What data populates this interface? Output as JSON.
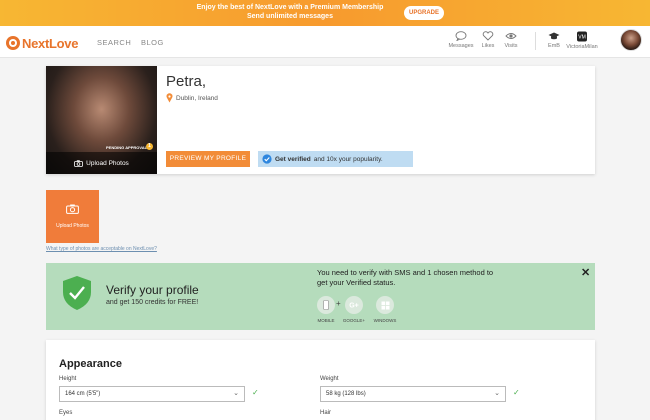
{
  "promo": {
    "line1": "Enjoy the best of NextLove with a Premium Membership",
    "line2": "Send unlimited messages",
    "upgrade_label": "UPGRADE"
  },
  "header": {
    "logo_text": "NextLove",
    "nav": {
      "search": "SEARCH",
      "blog": "BLOG"
    },
    "icons": {
      "messages": "Messages",
      "likes": "Likes",
      "visits": "Visits",
      "user1": "EmB",
      "user2": "VictoriaMilan"
    }
  },
  "profile": {
    "name": "Petra,",
    "location": "Dublin, Ireland",
    "pending_label": "PENDING APPROVAL",
    "pending_count": "1",
    "upload_label": "Upload Photos",
    "preview_label": "PREVIEW MY PROFILE",
    "verified_bold": "Get verified",
    "verified_rest": "and 10x your popularity."
  },
  "upload_tile": {
    "label": "Upload Photos",
    "link": "What type of photos are acceptable on NextLove?"
  },
  "verify": {
    "title": "Verify your profile",
    "subtitle": "and get 150 credits for FREE!",
    "text": "You need to verify with SMS and 1 chosen method to get your Verified status.",
    "close": "✕",
    "plus": "+",
    "options": [
      {
        "label": "MOBILE"
      },
      {
        "label": "GOOGLE+"
      },
      {
        "label": "WINDOWS"
      }
    ]
  },
  "appearance": {
    "title": "Appearance",
    "height_label": "Height",
    "height_value": "164 cm (5'5\")",
    "weight_label": "Weight",
    "weight_value": "58 kg (128 lbs)",
    "eyes_label": "Eyes",
    "hair_label": "Hair"
  },
  "colors": {
    "accent": "#e8742b",
    "promo": "#f7b733",
    "verify_bg": "#b5dcbc",
    "verified_strip": "#bfdcf2"
  }
}
